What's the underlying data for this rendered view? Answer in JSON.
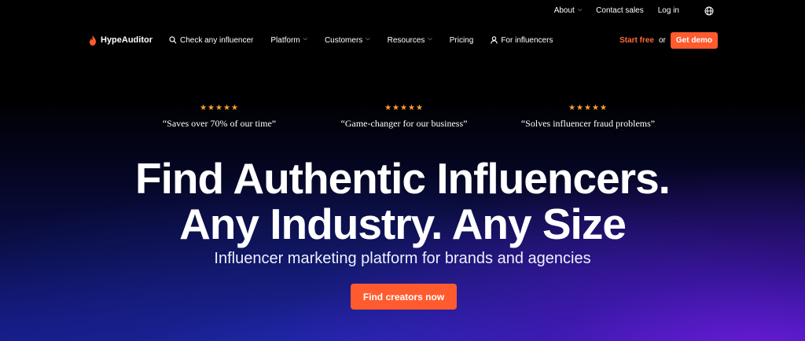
{
  "top_bar": {
    "about": "About",
    "contact_sales": "Contact sales",
    "log_in": "Log in",
    "language_icon": "globe-icon"
  },
  "nav": {
    "logo_text": "HypeAuditor",
    "logo_icon": "flame-icon",
    "check_influencer": "Check any influencer",
    "platform": "Platform",
    "customers": "Customers",
    "resources": "Resources",
    "pricing": "Pricing",
    "for_influencers": "For influencers",
    "start_free": "Start free",
    "or": "or",
    "get_demo": "Get demo"
  },
  "testimonials": [
    {
      "rating": 5,
      "stars": "★★★★★",
      "quote": "“Saves over 70% of our time”"
    },
    {
      "rating": 5,
      "stars": "★★★★★",
      "quote": "“Game-changer for our business”"
    },
    {
      "rating": 5,
      "stars": "★★★★★",
      "quote": "“Solves influencer fraud problems”"
    }
  ],
  "hero": {
    "headline_line1": "Find Authentic Influencers.",
    "headline_line2": "Any Industry. Any Size",
    "subheadline": "Influencer marketing platform for brands and agencies",
    "cta": "Find creators now"
  },
  "colors": {
    "accent": "#ff5b2e",
    "star": "#ffa229",
    "background_top": "#000000",
    "gradient_blue": "#1d2bd0",
    "gradient_purple": "#7a1ce6"
  }
}
